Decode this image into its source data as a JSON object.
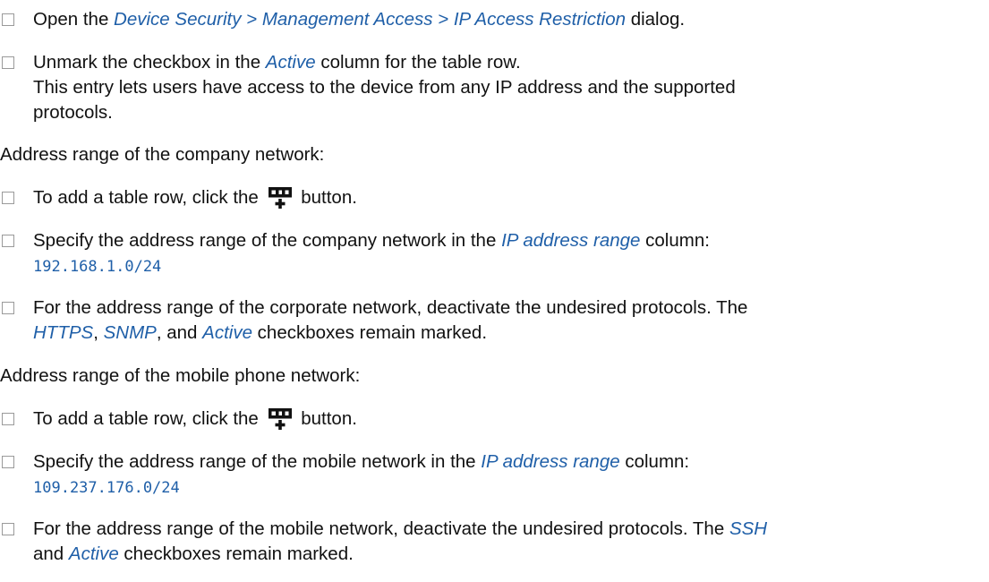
{
  "colors": {
    "ui_reference": "#1f5fa8",
    "checkbox_border": "#9a9a9a",
    "text": "#111111"
  },
  "icons": {
    "add_row": "add-table-row-icon",
    "step": "checkbox-icon"
  },
  "step1": {
    "pre": "Open the ",
    "path": "Device Security > Management Access > IP Access Restriction",
    "post": " dialog."
  },
  "step2": {
    "pre": "Unmark the checkbox in the ",
    "ref": "Active",
    "post": " column for the table row.",
    "note1": "This entry lets users have access to the device from any IP address and the supported",
    "note2": "protocols."
  },
  "heading1": "Address range of the company network:",
  "step3": {
    "pre": "To add a table row, click the ",
    "post": " button."
  },
  "step4": {
    "pre": "Specify the address range of the company network in the ",
    "ref": "IP address range",
    "post": " column:",
    "value": "192.168.1.0/24"
  },
  "step5": {
    "line1": "For the address range of the corporate network, deactivate the undesired protocols. The",
    "ref1": "HTTPS",
    "sep1": ", ",
    "ref2": "SNMP",
    "sep2": ", and ",
    "ref3": "Active",
    "post": " checkboxes remain marked."
  },
  "heading2": "Address range of the mobile phone network:",
  "step6": {
    "pre": "To add a table row, click the ",
    "post": " button."
  },
  "step7": {
    "pre": "Specify the address range of the mobile network in the ",
    "ref": "IP address range",
    "post": " column:",
    "value": "109.237.176.0/24"
  },
  "step8": {
    "line1": "For the address range of the mobile network, deactivate the undesired protocols. The ",
    "ref1": "SSH",
    "line2_pre": "and ",
    "ref2": "Active",
    "post": " checkboxes remain marked."
  }
}
